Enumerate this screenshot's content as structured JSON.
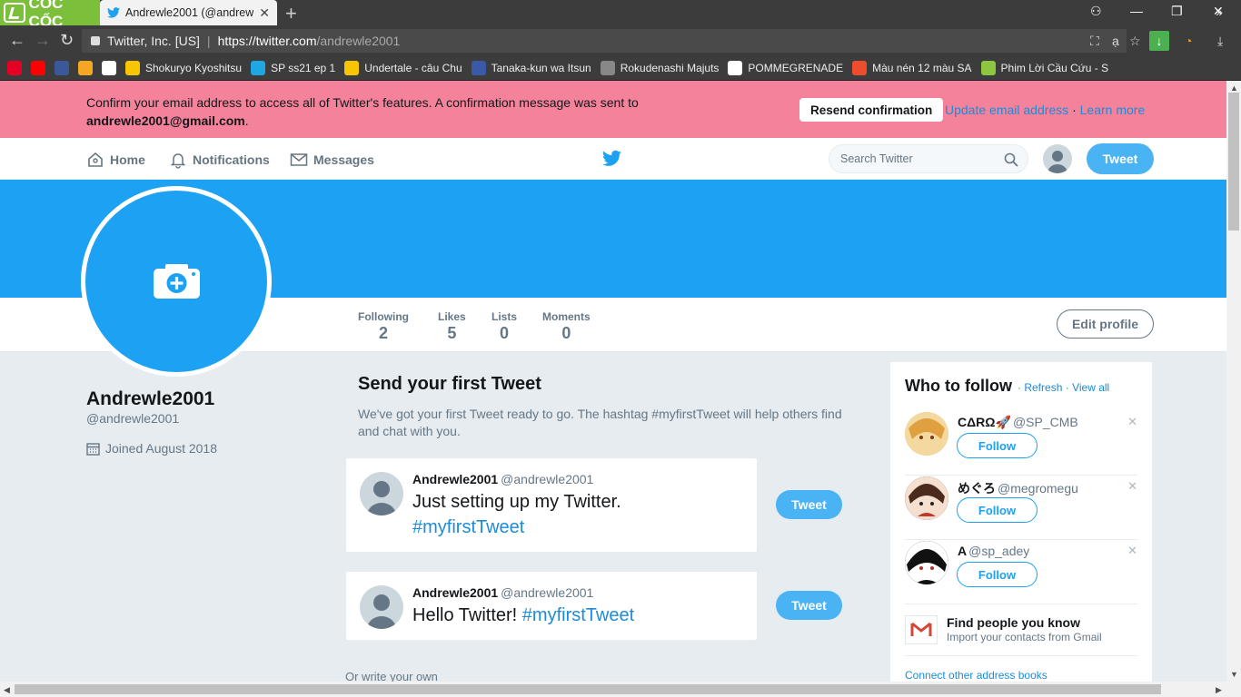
{
  "browser": {
    "brand": "CỐC CỐC",
    "tab_title": "Andrewle2001 (@andrewle",
    "url_site": "Twitter, Inc. [US]",
    "url_host": "https://twitter.com",
    "url_path": "/andrewle2001",
    "bookmarks": [
      {
        "label": "",
        "color": "#e60023"
      },
      {
        "label": "",
        "color": "#ff0000"
      },
      {
        "label": "",
        "color": "#3b5998"
      },
      {
        "label": "",
        "color": "#f5a623"
      },
      {
        "label": "",
        "color": "#ffffff"
      },
      {
        "label": "Shokuryo Kyoshitsu",
        "color": "#f7c600"
      },
      {
        "label": "SP ss21 ep 1",
        "color": "#1ea7e1"
      },
      {
        "label": "Undertale - câu Chu",
        "color": "#f7c600"
      },
      {
        "label": "Tanaka-kun wa Itsun",
        "color": "#3a5aa8"
      },
      {
        "label": "Rokudenashi Majuts",
        "color": "#888888"
      },
      {
        "label": "POMMEGRENADE",
        "color": "#ffffff"
      },
      {
        "label": "Màu nén 12 màu SA",
        "color": "#ee4d2d"
      },
      {
        "label": "Phim Lời Cầu Cứu - S",
        "color": "#8dc63f"
      }
    ]
  },
  "banner": {
    "message": "Confirm your email address to access all of Twitter's features. A confirmation message was sent to",
    "email": "andrewle2001@gmail.com",
    "resend_label": "Resend confirmation",
    "update_label": "Update email address",
    "learn_label": "Learn more"
  },
  "nav": {
    "home": "Home",
    "notifications": "Notifications",
    "messages": "Messages",
    "search_placeholder": "Search Twitter",
    "tweet_label": "Tweet"
  },
  "profile": {
    "name": "Andrewle2001",
    "handle": "@andrewle2001",
    "joined": "Joined August 2018",
    "edit_label": "Edit profile",
    "stats": [
      {
        "label": "Following",
        "value": "2"
      },
      {
        "label": "Likes",
        "value": "5"
      },
      {
        "label": "Lists",
        "value": "0"
      },
      {
        "label": "Moments",
        "value": "0"
      }
    ]
  },
  "first_tweet": {
    "title": "Send your first Tweet",
    "description": "We've got your first Tweet ready to go. The hashtag #myfirstTweet will help others find and chat with you.",
    "cards": [
      {
        "name": "Andrewle2001",
        "handle": "@andrewle2001",
        "text": "Just setting up my Twitter.",
        "hashtag": "#myfirstTweet",
        "button": "Tweet"
      },
      {
        "name": "Andrewle2001",
        "handle": "@andrewle2001",
        "text": "Hello Twitter!",
        "hashtag": "#myfirstTweet",
        "button": "Tweet"
      }
    ],
    "or_write": "Or write your own"
  },
  "who_to_follow": {
    "title": "Who to follow",
    "refresh": "Refresh",
    "view_all": "View all",
    "follow_label": "Follow",
    "accounts": [
      {
        "name": "CΔRΩ🚀",
        "handle": "@SP_CMB",
        "avatar_color": "#f0c070"
      },
      {
        "name": "めぐろ",
        "handle": "@megromegu",
        "avatar_color": "#5a3a2a"
      },
      {
        "name": "A",
        "handle": "@sp_adey",
        "avatar_color": "#1a1a1a"
      }
    ],
    "find_title": "Find people you know",
    "find_sub": "Import your contacts from Gmail",
    "connect": "Connect other address books"
  }
}
